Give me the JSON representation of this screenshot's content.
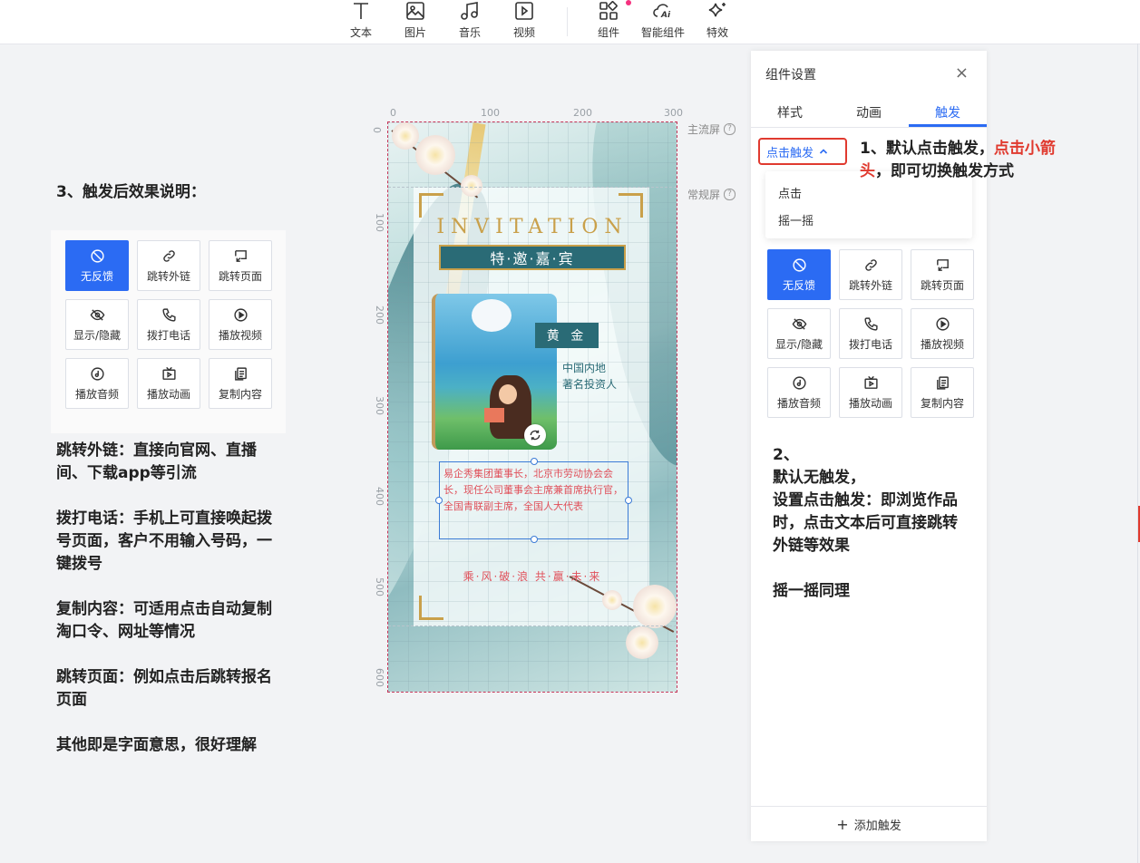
{
  "toolbar": {
    "items": [
      {
        "label": "文本",
        "icon": "text-icon"
      },
      {
        "label": "图片",
        "icon": "image-icon"
      },
      {
        "label": "音乐",
        "icon": "music-icon"
      },
      {
        "label": "视频",
        "icon": "video-icon"
      },
      {
        "label": "组件",
        "icon": "components-icon"
      },
      {
        "label": "智能组件",
        "icon": "ai-cloud-icon"
      },
      {
        "label": "特效",
        "icon": "sparkle-icon"
      }
    ],
    "notification_color": "#f5317f"
  },
  "left": {
    "heading": "3、触发后效果说明：",
    "notes": [
      "跳转外链：直接向官网、直播间、下载app等引流",
      "拨打电话：手机上可直接唤起拨号页面，客户不用输入号码，一键拨号",
      "复制内容：可适用点击自动复制淘口令、网址等情况",
      "跳转页面：例如点击后跳转报名页面",
      "其他即是字面意思，很好理解"
    ]
  },
  "actions": [
    {
      "label": "无反馈",
      "icon": "no-feedback-icon",
      "selected": true
    },
    {
      "label": "跳转外链",
      "icon": "link-icon"
    },
    {
      "label": "跳转页面",
      "icon": "page-jump-icon"
    },
    {
      "label": "显示/隐藏",
      "icon": "eye-hide-icon"
    },
    {
      "label": "拨打电话",
      "icon": "phone-icon"
    },
    {
      "label": "播放视频",
      "icon": "play-video-icon"
    },
    {
      "label": "播放音频",
      "icon": "audio-icon"
    },
    {
      "label": "播放动画",
      "icon": "animation-icon"
    },
    {
      "label": "复制内容",
      "icon": "copy-icon"
    }
  ],
  "canvas": {
    "ruler_top": [
      "0",
      "100",
      "200",
      "300"
    ],
    "ruler_left": [
      "0",
      "100",
      "200",
      "300",
      "400",
      "500",
      "600"
    ],
    "main_screen_label": "主流屏",
    "normal_screen_label": "常规屏",
    "invitation": "INVITATION",
    "banner": "特·邀·嘉·宾",
    "badge": "黄 金",
    "role_line1": "中国内地",
    "role_line2": "著名投资人",
    "bio": "易企秀集团董事长，北京市劳动协会会长，现任公司董事会主席兼首席执行官，全国青联副主席，全国人大代表",
    "slogan": "乘·风·破·浪  共·赢·未·来"
  },
  "panel": {
    "title": "组件设置",
    "close": "×",
    "tabs": [
      "样式",
      "动画",
      "触发"
    ],
    "active_tab": "触发",
    "trigger_select": "点击触发",
    "dropdown_options": [
      "点击",
      "摇一摇"
    ],
    "add_trigger": "添加触发",
    "accent": "#2b6bf3",
    "highlight": "#e03a2f"
  },
  "callouts": {
    "c1_a": "1、默认点击触发，",
    "c1_red": "点击小箭头",
    "c1_b": "，即可切换触发方式",
    "c2_lines": [
      "2、",
      "默认无触发，",
      "设置点击触发：即浏览作品时，点击文本后可直接跳转外链等效果",
      "",
      "摇一摇同理"
    ]
  }
}
